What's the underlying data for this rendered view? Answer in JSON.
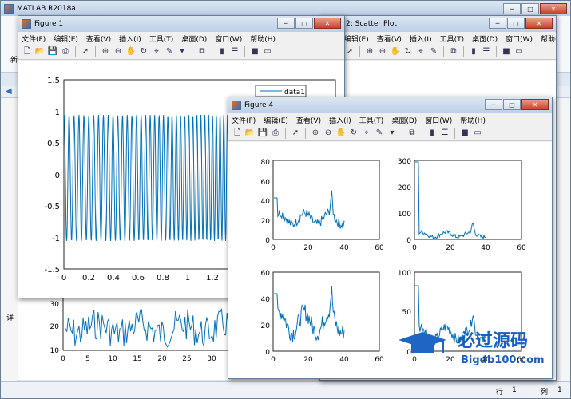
{
  "main_window": {
    "title": "MATLAB R2018a",
    "left_label": "新",
    "side_label": "详",
    "status": {
      "row_label": "行",
      "row_value": "1",
      "col_label": "列",
      "col_value": "1"
    }
  },
  "figure2": {
    "title": "2: Scatter Plot"
  },
  "figure1": {
    "title": "Figure 1",
    "menu": [
      "文件(F)",
      "编辑(E)",
      "查看(V)",
      "插入(I)",
      "工具(T)",
      "桌面(D)",
      "窗口(W)",
      "帮助(H)"
    ],
    "plot": {
      "legend": "data1",
      "y_ticks": [
        "1.5",
        "1",
        "0.5",
        "0",
        "-0.5",
        "-1",
        "-1.5"
      ],
      "x_ticks": [
        "0",
        "0.2",
        "0.4",
        "0.6",
        "0.8",
        "1",
        "1.2"
      ]
    }
  },
  "behind_plot": {
    "y_ticks": [
      "30",
      "20",
      "10"
    ],
    "x_ticks": [
      "0",
      "5",
      "10",
      "15",
      "20",
      "25",
      "30"
    ]
  },
  "figure4": {
    "title": "Figure 4",
    "menu": [
      "文件(F)",
      "编辑(E)",
      "查看(V)",
      "插入(I)",
      "工具(T)",
      "桌面(D)",
      "窗口(W)",
      "帮助(H)"
    ],
    "subplots": [
      {
        "y_ticks": [
          "80",
          "60",
          "40",
          "20",
          "0"
        ],
        "x_ticks": [
          "0",
          "20",
          "40",
          "60"
        ]
      },
      {
        "y_ticks": [
          "300",
          "200",
          "100",
          "0"
        ],
        "x_ticks": [
          "0",
          "20",
          "40",
          "60"
        ]
      },
      {
        "y_ticks": [
          "60",
          "40",
          "20",
          "0"
        ],
        "x_ticks": [
          "0",
          "20",
          "40",
          "60"
        ]
      },
      {
        "y_ticks": [
          "100",
          "50",
          "0"
        ],
        "x_ticks": [
          "0",
          "20",
          "40",
          "60"
        ]
      }
    ]
  },
  "watermark": {
    "brand": "必过源码",
    "url": "Bigdb100.com"
  },
  "colors": {
    "line": "#0072bd",
    "desktop": "#6f8fb0"
  }
}
